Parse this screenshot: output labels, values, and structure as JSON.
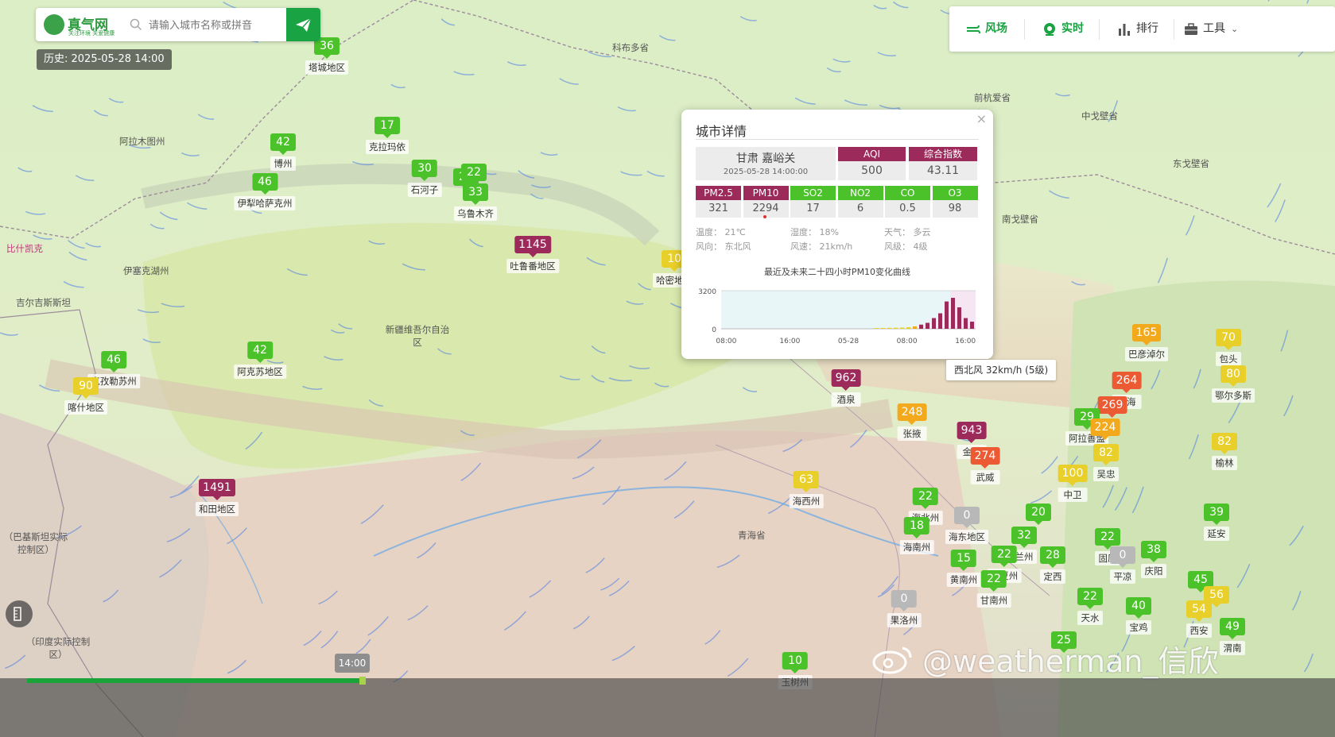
{
  "search": {
    "placeholder": "请输入城市名称或拼音",
    "brand": "真气网",
    "brand_sub": "关注环境 关爱健康"
  },
  "history_label": "历史: 2025-05-28 14:00",
  "toolbar": [
    {
      "id": "wind",
      "label": "风场",
      "icon": "wind-field-icon",
      "active": true
    },
    {
      "id": "live",
      "label": "实时",
      "icon": "realtime-icon",
      "active": true
    },
    {
      "id": "rank",
      "label": "排行",
      "icon": "ranking-icon",
      "active": false
    },
    {
      "id": "tools",
      "label": "工具",
      "icon": "toolbox-icon",
      "active": false
    }
  ],
  "colors": {
    "good": "#4cc22a",
    "moderate": "#e8cf29",
    "sensitive": "#f2a91c",
    "unhealthy": "#ec5a33",
    "hazardous": "#9c2a5b",
    "nodata": "#b8b8b8",
    "brand": "#1aa342"
  },
  "regions": [
    {
      "text": "科布多省"
    },
    {
      "text": "阿拉木图州"
    },
    {
      "text": "伊塞克湖州"
    },
    {
      "text": "吉尔吉斯斯坦"
    },
    {
      "text": "比什凯克"
    },
    {
      "text": "新疆维吾尔自治区"
    },
    {
      "text": "青海省"
    },
    {
      "text": "前杭爱省"
    },
    {
      "text": "中戈壁省"
    },
    {
      "text": "东戈壁省"
    },
    {
      "text": "南戈壁省"
    },
    {
      "text": "（巴基斯坦实际控制区）"
    },
    {
      "text": "（印度实际控制区）"
    }
  ],
  "stations": [
    {
      "value": "36",
      "level": "green",
      "city": "塔城地区"
    },
    {
      "value": "17",
      "level": "green",
      "city": "克拉玛依"
    },
    {
      "value": "42",
      "level": "green",
      "city": "博州"
    },
    {
      "value": "46",
      "level": "green",
      "city": "伊犁哈萨克州"
    },
    {
      "value": "30",
      "level": "green",
      "city": "石河子"
    },
    {
      "value": "21",
      "level": "green",
      "city": ""
    },
    {
      "value": "22",
      "level": "green",
      "city": ""
    },
    {
      "value": "33",
      "level": "green",
      "city": "乌鲁木齐"
    },
    {
      "value": "1145",
      "level": "maroon",
      "city": "吐鲁番地区"
    },
    {
      "value": "10",
      "level": "yellow",
      "city": "哈密地区"
    },
    {
      "value": "42",
      "level": "green",
      "city": "阿克苏地区"
    },
    {
      "value": "46",
      "level": "green",
      "city": "克孜勒苏州"
    },
    {
      "value": "90",
      "level": "yellow",
      "city": "喀什地区"
    },
    {
      "value": "1491",
      "level": "maroon",
      "city": "和田地区"
    },
    {
      "value": "962",
      "level": "maroon",
      "city": "酒泉"
    },
    {
      "value": "248",
      "level": "orange",
      "city": "张掖"
    },
    {
      "value": "943",
      "level": "maroon",
      "city": "金昌"
    },
    {
      "value": "274",
      "level": "red",
      "city": "武威"
    },
    {
      "value": "63",
      "level": "yellow",
      "city": "海西州"
    },
    {
      "value": "22",
      "level": "green",
      "city": "海北州"
    },
    {
      "value": "0",
      "level": "gray",
      "city": "海东地区"
    },
    {
      "value": "18",
      "level": "green",
      "city": "海南州"
    },
    {
      "value": "20",
      "level": "green",
      "city": ""
    },
    {
      "value": "32",
      "level": "green",
      "city": "兰州"
    },
    {
      "value": "15",
      "level": "green",
      "city": "黄南州"
    },
    {
      "value": "22",
      "level": "green",
      "city": "临夏州"
    },
    {
      "value": "28",
      "level": "green",
      "city": "定西"
    },
    {
      "value": "22",
      "level": "green",
      "city": "甘南州"
    },
    {
      "value": "0",
      "level": "gray",
      "city": "果洛州"
    },
    {
      "value": "165",
      "level": "orange",
      "city": "巴彦淖尔"
    },
    {
      "value": "264",
      "level": "red",
      "city": "乌海"
    },
    {
      "value": "269",
      "level": "red",
      "city": ""
    },
    {
      "value": "29",
      "level": "green",
      "city": "阿拉善盟"
    },
    {
      "value": "224",
      "level": "orange",
      "city": ""
    },
    {
      "value": "82",
      "level": "yellow",
      "city": "吴忠"
    },
    {
      "value": "100",
      "level": "yellow",
      "city": "中卫"
    },
    {
      "value": "22",
      "level": "green",
      "city": "固原"
    },
    {
      "value": "0",
      "level": "gray",
      "city": "平凉"
    },
    {
      "value": "38",
      "level": "green",
      "city": "庆阳"
    },
    {
      "value": "22",
      "level": "green",
      "city": "天水"
    },
    {
      "value": "40",
      "level": "green",
      "city": "宝鸡"
    },
    {
      "value": "70",
      "level": "yellow",
      "city": "包头"
    },
    {
      "value": "80",
      "level": "yellow",
      "city": "鄂尔多斯"
    },
    {
      "value": "82",
      "level": "yellow",
      "city": "榆林"
    },
    {
      "value": "39",
      "level": "green",
      "city": "延安"
    },
    {
      "value": "45",
      "level": "green",
      "city": ""
    },
    {
      "value": "56",
      "level": "yellow",
      "city": ""
    },
    {
      "value": "54",
      "level": "yellow",
      "city": "西安"
    },
    {
      "value": "49",
      "level": "green",
      "city": "渭南"
    },
    {
      "value": "25",
      "level": "green",
      "city": ""
    },
    {
      "value": "10",
      "level": "green",
      "city": "玉树州"
    }
  ],
  "popup": {
    "title": "城市详情",
    "city": "甘肃 嘉峪关",
    "time": "2025-05-28 14:00:00",
    "aqi_label": "AQI",
    "aqi": "500",
    "index_label": "综合指数",
    "index": "43.11",
    "pollutants": [
      {
        "name": "PM2.5",
        "value": "321",
        "level": "maroon"
      },
      {
        "name": "PM10",
        "value": "2294",
        "level": "maroon"
      },
      {
        "name": "SO2",
        "value": "17",
        "level": "green"
      },
      {
        "name": "NO2",
        "value": "6",
        "level": "green"
      },
      {
        "name": "CO",
        "value": "0.5",
        "level": "green"
      },
      {
        "name": "O3",
        "value": "98",
        "level": "green"
      }
    ],
    "meteo": {
      "temp": "温度： 21℃",
      "humidity": "湿度： 18%",
      "weather": "天气： 多云",
      "wind_dir": "风向： 东北风",
      "wind_speed": "风速： 21km/h",
      "wind_level": "风级： 4级"
    },
    "chart_title": "最近及未来二十四小时PM10变化曲线"
  },
  "chart_data": {
    "type": "bar",
    "title": "最近及未来二十四小时PM10变化曲线",
    "ylim": [
      0,
      3200
    ],
    "yticks": [
      "3200",
      "0"
    ],
    "xticks": [
      "08:00",
      "16:00",
      "05-28",
      "08:00",
      "16:00"
    ],
    "values": [
      null,
      null,
      null,
      null,
      null,
      null,
      null,
      null,
      null,
      null,
      null,
      null,
      null,
      null,
      null,
      null,
      null,
      null,
      null,
      null,
      null,
      null,
      null,
      null,
      60,
      70,
      80,
      90,
      100,
      130,
      200,
      350,
      500,
      900,
      1300,
      2294,
      2600,
      1800,
      900,
      600
    ],
    "forecast_from": 36
  },
  "wind_tooltip": "西北风 32km/h (5级)",
  "timeline": {
    "current": "14:00",
    "progress": 0.27
  },
  "watermark": "@weatherman_信欣"
}
